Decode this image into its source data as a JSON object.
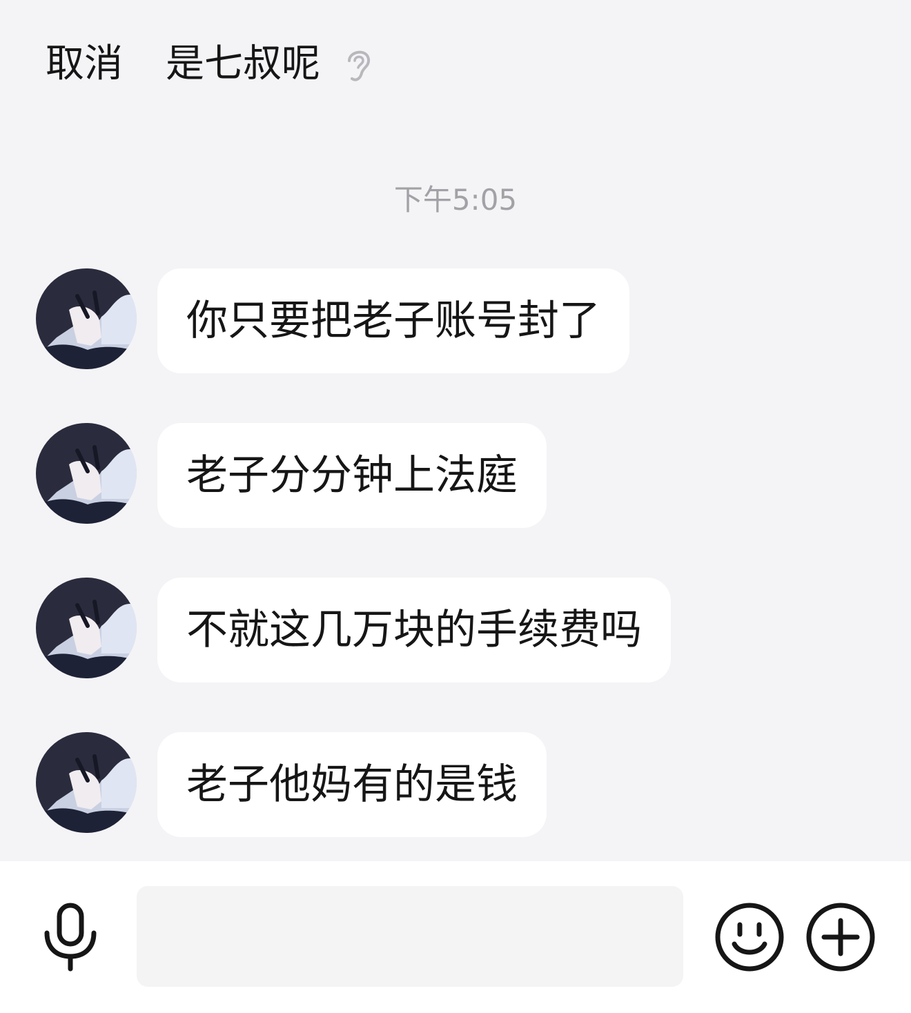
{
  "header": {
    "cancel_label": "取消",
    "title": "是七叔呢",
    "mode_icon": "ear-icon"
  },
  "chat": {
    "timestamp": "下午5:05",
    "messages": [
      {
        "text": "你只要把老子账号封了",
        "sender": "other"
      },
      {
        "text": "老子分分钟上法庭",
        "sender": "other"
      },
      {
        "text": "不就这几万块的手续费吗",
        "sender": "other"
      },
      {
        "text": "老子他妈有的是钱",
        "sender": "other"
      }
    ]
  },
  "inputbar": {
    "voice_icon": "microphone-icon",
    "input_value": "",
    "emoji_icon": "smiley-icon",
    "more_icon": "plus-icon"
  },
  "colors": {
    "background": "#f4f3f6",
    "bubble": "#ffffff",
    "timestamp": "#a2a2a6",
    "text": "#161616"
  }
}
